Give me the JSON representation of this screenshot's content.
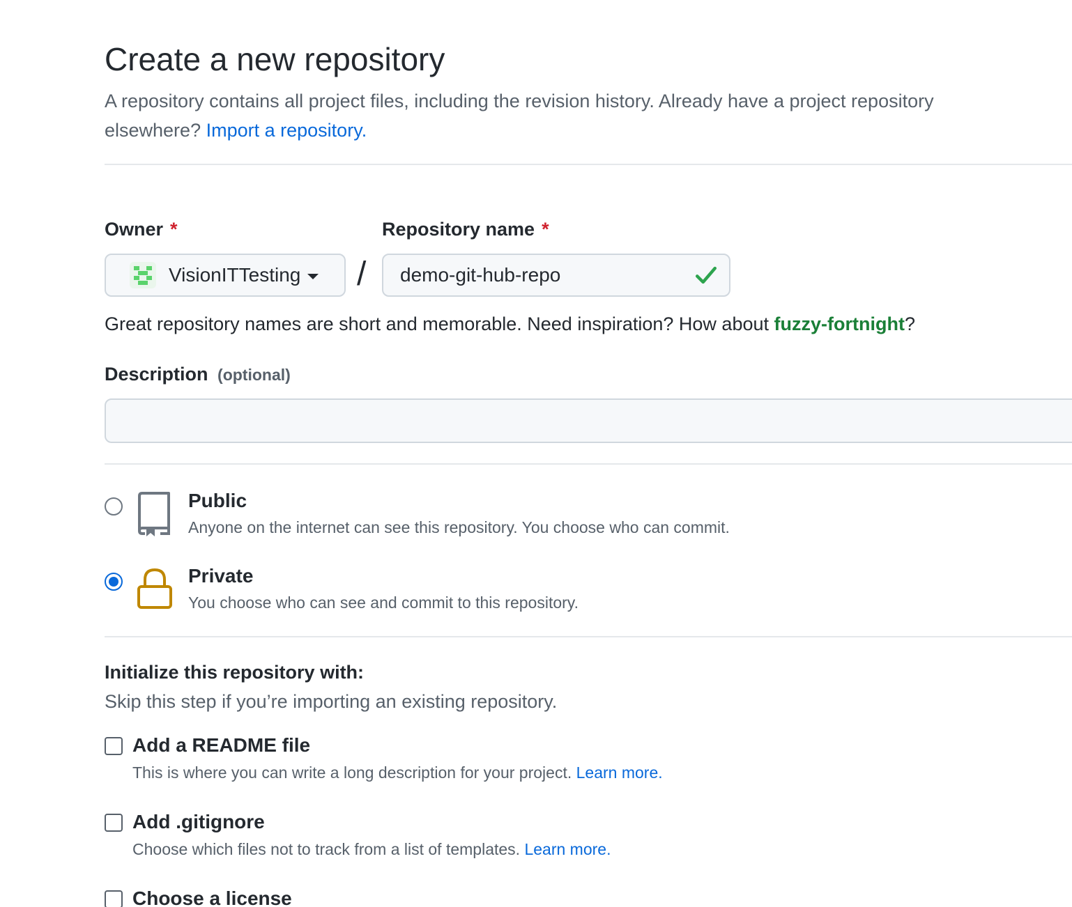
{
  "header": {
    "title": "Create a new repository",
    "description": "A repository contains all project files, including the revision history. Already have a project repository elsewhere?",
    "import_link": "Import a repository."
  },
  "owner": {
    "label": "Owner",
    "required_mark": "*",
    "selected": "VisionITTesting",
    "icon": "identicon-avatar"
  },
  "separator": "/",
  "repo_name": {
    "label": "Repository name",
    "required_mark": "*",
    "value": "demo-git-hub-repo",
    "valid_icon": "check-icon",
    "valid_color": "#2da44e"
  },
  "name_hint": {
    "text": "Great repository names are short and memorable. Need inspiration? How about",
    "suggestion": "fuzzy-fortnight",
    "end": "?"
  },
  "description": {
    "label": "Description",
    "optional": "(optional)",
    "value": ""
  },
  "visibility": {
    "selected": "private",
    "options": [
      {
        "id": "public",
        "title": "Public",
        "desc": "Anyone on the internet can see this repository. You choose who can commit.",
        "icon": "repo-icon",
        "checked": false
      },
      {
        "id": "private",
        "title": "Private",
        "desc": "You choose who can see and commit to this repository.",
        "icon": "lock-icon",
        "checked": true
      }
    ]
  },
  "init": {
    "title": "Initialize this repository with:",
    "subtitle": "Skip this step if you’re importing an existing repository.",
    "options": [
      {
        "title": "Add a README file",
        "desc": "This is where you can write a long description for your project.",
        "link": "Learn more.",
        "checked": false
      },
      {
        "title": "Add .gitignore",
        "desc": "Choose which files not to track from a list of templates.",
        "link": "Learn more.",
        "checked": false
      },
      {
        "title": "Choose a license",
        "checked": false
      }
    ]
  },
  "colors": {
    "link": "#0969da",
    "suggestion": "#1a7f37",
    "required": "#cf222e",
    "radio_selected": "#0969da",
    "lock_icon": "#bf8700"
  }
}
